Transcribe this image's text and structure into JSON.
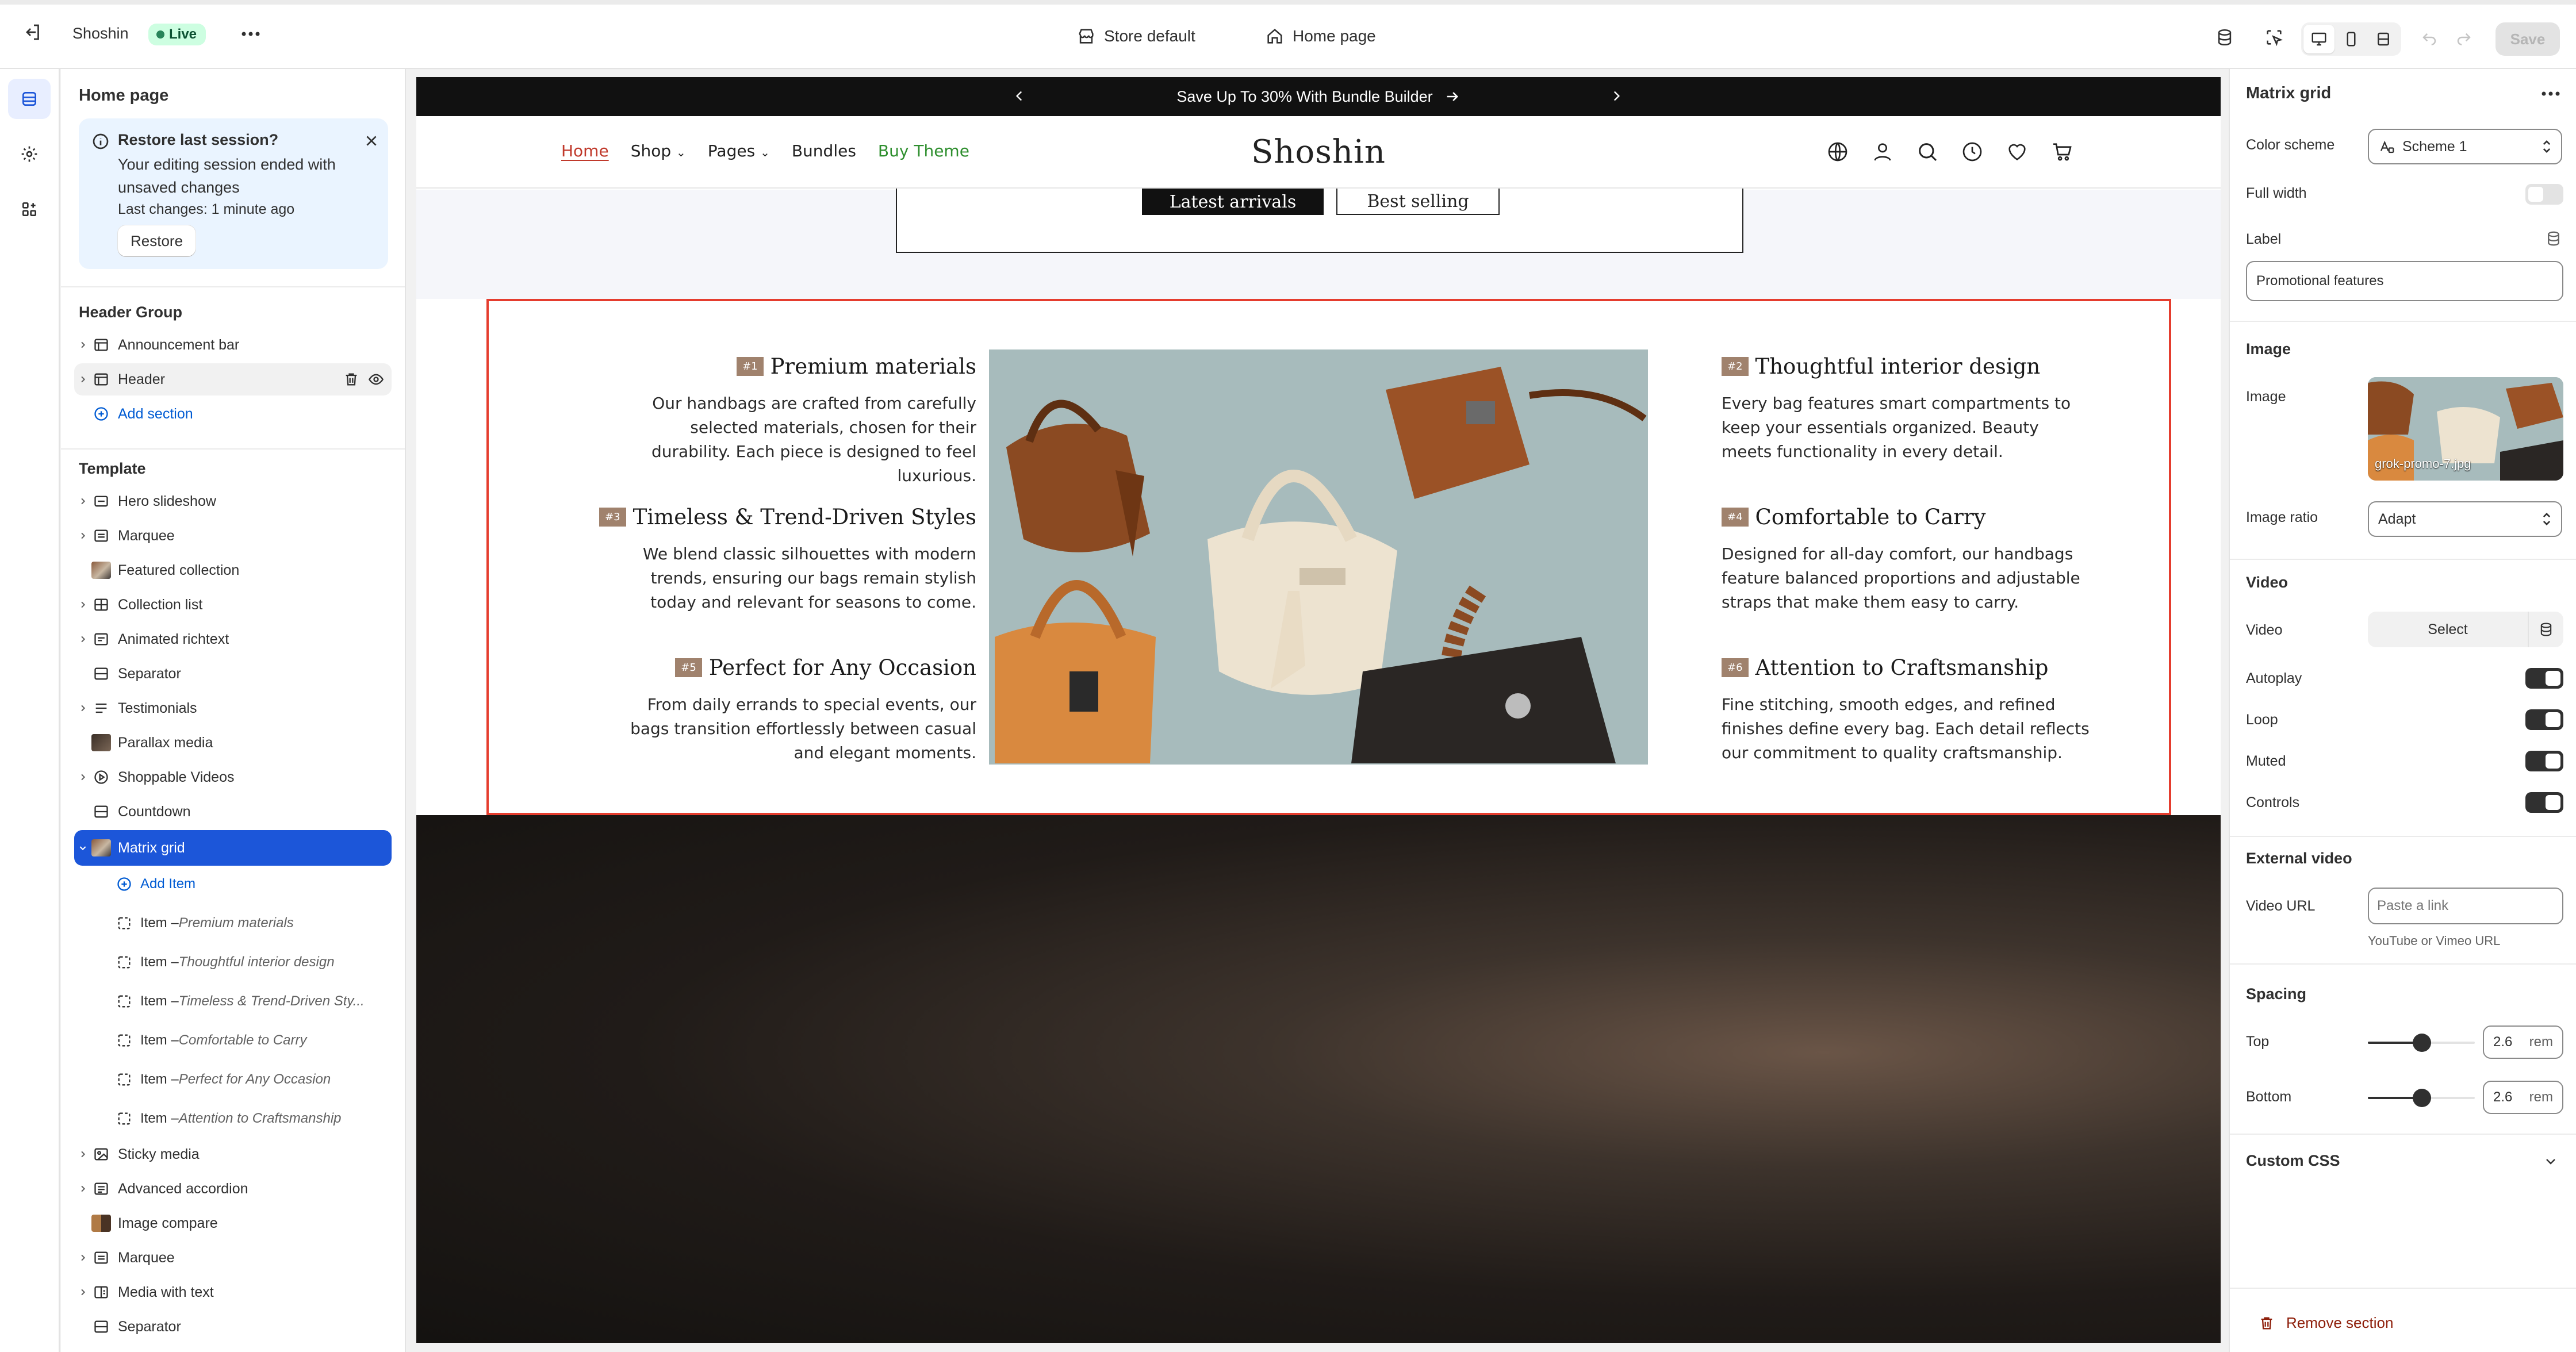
{
  "topbar": {
    "store_name": "Shoshin",
    "status": "Live",
    "theme_label": "Store default",
    "page_label": "Home page",
    "save_label": "Save"
  },
  "sidebar": {
    "title": "Home page",
    "restore": {
      "title": "Restore last session?",
      "body": "Your editing session ended with unsaved changes",
      "meta": "Last changes: 1 minute ago",
      "button": "Restore"
    },
    "header_group": {
      "title": "Header Group",
      "items": [
        "Announcement bar",
        "Header"
      ],
      "add_section": "Add section"
    },
    "template": {
      "title": "Template",
      "sections_top": [
        "Hero slideshow",
        "Marquee",
        "Featured collection",
        "Collection list",
        "Animated richtext",
        "Separator",
        "Testimonials",
        "Parallax media",
        "Shoppable Videos",
        "Countdown"
      ],
      "selected": "Matrix grid",
      "add_item": "Add Item",
      "items": [
        {
          "prefix": "Item – ",
          "name": "Premium materials"
        },
        {
          "prefix": "Item – ",
          "name": "Thoughtful interior design"
        },
        {
          "prefix": "Item – ",
          "name": "Timeless & Trend-Driven Sty..."
        },
        {
          "prefix": "Item – ",
          "name": "Comfortable to Carry"
        },
        {
          "prefix": "Item – ",
          "name": "Perfect for Any Occasion"
        },
        {
          "prefix": "Item – ",
          "name": "Attention to Craftsmanship"
        }
      ],
      "sections_bottom": [
        "Sticky media",
        "Advanced accordion",
        "Image compare",
        "Marquee",
        "Media with text",
        "Separator"
      ]
    }
  },
  "preview": {
    "announcement": "Save Up To 30% With Bundle Builder",
    "nav": {
      "home": "Home",
      "shop": "Shop",
      "pages": "Pages",
      "bundles": "Bundles",
      "buy": "Buy Theme"
    },
    "logo": "Shoshin",
    "collection_tabs": [
      "Latest arrivals",
      "Best selling"
    ],
    "features": [
      {
        "num": "#1",
        "title": "Premium materials",
        "body": "Our handbags are crafted from carefully selected materials, chosen for their durability. Each piece is designed to feel luxurious."
      },
      {
        "num": "#2",
        "title": "Thoughtful interior design",
        "body": "Every bag features smart compartments to keep your essentials organized. Beauty meets functionality in every detail."
      },
      {
        "num": "#3",
        "title": "Timeless & Trend-Driven Styles",
        "body": "We blend classic silhouettes with modern trends, ensuring our bags remain stylish today and relevant for seasons to come."
      },
      {
        "num": "#4",
        "title": "Comfortable to Carry",
        "body": "Designed for all-day comfort, our handbags feature balanced proportions and adjustable straps that make them easy to carry."
      },
      {
        "num": "#5",
        "title": "Perfect for Any Occasion",
        "body": "From daily errands to special events, our bags transition effortlessly between casual and elegant moments."
      },
      {
        "num": "#6",
        "title": "Attention to Craftsmanship",
        "body": "Fine stitching, smooth edges, and refined finishes define every bag. Each detail reflects our commitment to quality craftsmanship."
      }
    ]
  },
  "settings": {
    "title": "Matrix grid",
    "color_scheme_label": "Color scheme",
    "color_scheme_value": "Scheme 1",
    "full_width_label": "Full width",
    "label_label": "Label",
    "label_value": "Promotional features",
    "image_section": "Image",
    "image_label": "Image",
    "image_filename": "grok-promo-7.jpg",
    "ratio_label": "Image ratio",
    "ratio_value": "Adapt",
    "video_section": "Video",
    "video_label": "Video",
    "video_select": "Select",
    "autoplay": "Autoplay",
    "loop": "Loop",
    "muted": "Muted",
    "controls": "Controls",
    "external_section": "External video",
    "video_url_label": "Video URL",
    "video_url_placeholder": "Paste a link",
    "video_url_help": "YouTube or Vimeo URL",
    "spacing_section": "Spacing",
    "top_label": "Top",
    "top_value": "2.6",
    "bottom_label": "Bottom",
    "bottom_value": "2.6",
    "unit": "rem",
    "custom_css": "Custom CSS",
    "remove_section": "Remove section"
  },
  "colors": {
    "accent_blue": "#1c56d9",
    "selection_red": "#e53d2e",
    "live_green": "#29845a",
    "buy_theme_green": "#2f8f2f"
  }
}
